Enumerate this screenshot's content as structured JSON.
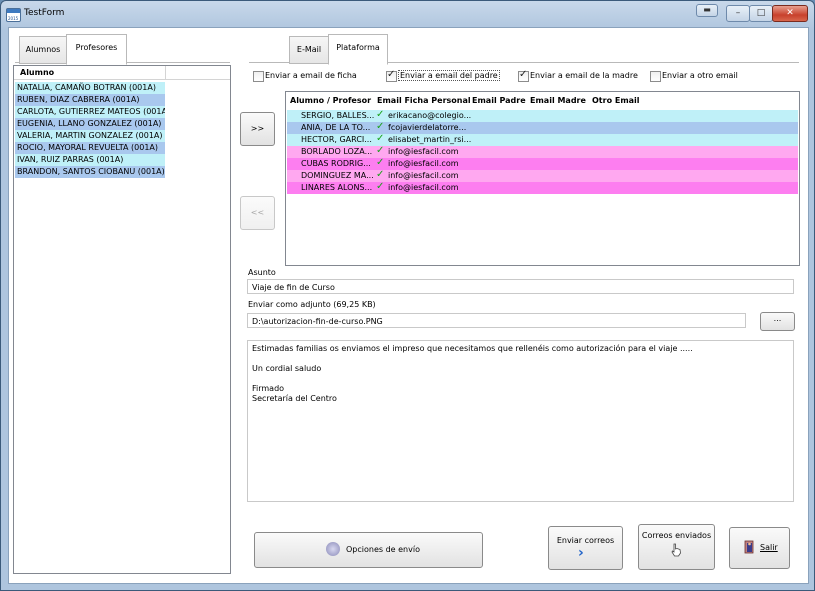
{
  "window": {
    "title": "TestForm",
    "icon_year": "2015",
    "controls": {
      "minimize": "–",
      "maximize": "□",
      "close": "✕",
      "restore": "▬"
    }
  },
  "left_tabs": [
    "Alumnos",
    "Profesores"
  ],
  "alumnos_grid": {
    "header": "Alumno",
    "rows": [
      {
        "name": "NATALIA, CAMAÑO BOTRAN (001A)",
        "color": "#bff0f8"
      },
      {
        "name": "RUBEN, DIAZ CABRERA (001A)",
        "color": "#a9c8ee"
      },
      {
        "name": "CARLOTA, GUTIERREZ MATEOS (001A)",
        "color": "#bff0f8"
      },
      {
        "name": "EUGENIA, LLANO GONZALEZ (001A)",
        "color": "#a9c8ee"
      },
      {
        "name": "VALERIA, MARTIN GONZALEZ (001A)",
        "color": "#bff0f8"
      },
      {
        "name": "ROCIO, MAYORAL REVUELTA (001A)",
        "color": "#a9c8ee"
      },
      {
        "name": "IVAN, RUIZ PARRAS (001A)",
        "color": "#bff0f8"
      },
      {
        "name": "BRANDON, SANTOS CIOBANU (001A)",
        "color": "#a9c8ee"
      }
    ]
  },
  "right_tabs": [
    "E-Mail",
    "Plataforma"
  ],
  "checkboxes": [
    {
      "label": "Enviar a email de ficha",
      "checked": false
    },
    {
      "label": "Enviar a email del padre",
      "checked": true
    },
    {
      "label": "Enviar a email de la madre",
      "checked": true
    },
    {
      "label": "Enviar a otro email",
      "checked": false
    }
  ],
  "move_right_label": ">>",
  "move_left_label": "<<",
  "dest_grid": {
    "columns": [
      "Alumno / Profesor",
      "Email Ficha Personal",
      "Email Padre",
      "Email Madre",
      "Otro Email"
    ],
    "rows": [
      {
        "name": "SERGIO, BALLES...",
        "email": "erikacano@colegio...",
        "color": "#bff0f8"
      },
      {
        "name": "ANIA, DE LA TO...",
        "email": "fcojavierdelatorre...",
        "color": "#a9c8ee"
      },
      {
        "name": "HECTOR, GARCI...",
        "email": "elisabet_martin_rsi...",
        "color": "#bff0f8"
      },
      {
        "name": "BORLADO LOZA...",
        "email": "info@iesfacil.com",
        "color": "#ffa8f0"
      },
      {
        "name": "CUBAS RODRIG...",
        "email": "info@iesfacil.com",
        "color": "#fd7ef0"
      },
      {
        "name": "DOMINGUEZ MA...",
        "email": "info@iesfacil.com",
        "color": "#ffa8f0"
      },
      {
        "name": "LINARES ALONS...",
        "email": "info@iesfacil.com",
        "color": "#fd7ef0"
      }
    ]
  },
  "asunto": {
    "label": "Asunto",
    "value": "Viaje de fin de Curso"
  },
  "adjunto": {
    "label": "Enviar como adjunto (69,25 KB)",
    "value": "D:\\autorizacion-fin-de-curso.PNG",
    "browse": "..."
  },
  "body_lines": [
    "Estimadas familias os enviamos el impreso que necesitamos que rellenéis como autorización para el viaje .....",
    "",
    "Un cordial saludo",
    "",
    "Firmado",
    "Secretaría del Centro"
  ],
  "buttons": {
    "opciones": "Opciones de envío",
    "enviar": "Enviar correos",
    "enviados": "Correos enviados",
    "salir": "Salir"
  }
}
